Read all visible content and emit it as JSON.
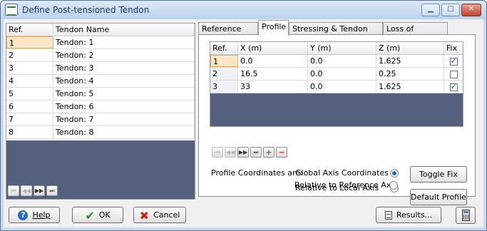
{
  "window": {
    "title": "Define Post-tensioned Tendon",
    "minimize_glyph": "▁",
    "maximize_glyph": "□",
    "close_glyph": "✕"
  },
  "tendon_list": {
    "headers": [
      "Ref.",
      "Tendon Name"
    ],
    "rows": [
      {
        "ref": "1",
        "name": "Tendon: 1"
      },
      {
        "ref": "2",
        "name": "Tendon: 2"
      },
      {
        "ref": "3",
        "name": "Tendon: 3"
      },
      {
        "ref": "4",
        "name": "Tendon: 4"
      },
      {
        "ref": "5",
        "name": "Tendon: 5"
      },
      {
        "ref": "6",
        "name": "Tendon: 6"
      },
      {
        "ref": "7",
        "name": "Tendon: 7"
      },
      {
        "ref": "8",
        "name": "Tendon: 8"
      }
    ],
    "selected_index": 0
  },
  "tabs": [
    {
      "label": "Reference Axis",
      "active": false
    },
    {
      "label": "Profile",
      "active": true
    },
    {
      "label": "Stressing & Tendon Data",
      "active": false
    },
    {
      "label": "Loss of Prestress",
      "active": false
    }
  ],
  "profile": {
    "headers": [
      "Ref.",
      "X (m)",
      "Y (m)",
      "Z (m)",
      "Fix"
    ],
    "rows": [
      {
        "ref": "1",
        "x": "0.0",
        "y": "0.0",
        "z": "1.625",
        "fix": true
      },
      {
        "ref": "2",
        "x": "16.5",
        "y": "0.0",
        "z": "0.25",
        "fix": false
      },
      {
        "ref": "3",
        "x": "33",
        "y": "0.0",
        "z": "1.625",
        "fix": true
      }
    ],
    "coordinates_label": "Profile Coordinates are:",
    "coordinate_options": [
      {
        "label": "Global Axis Coordinates",
        "selected": true
      },
      {
        "label": "Relative to Local Axis",
        "selected": false
      },
      {
        "label": "Relative to Reference Axis",
        "selected": false
      }
    ],
    "toggle_fix_label": "Toggle Fix",
    "default_profile_label": "Default Profile"
  },
  "nav_glyphs": {
    "first": "⏮",
    "prev": "◀◀",
    "next": "▶▶",
    "last": "⏭",
    "add": "+",
    "remove": "−"
  },
  "footer": {
    "help_label": "Help",
    "ok_label": "OK",
    "cancel_label": "Cancel",
    "results_label": "Results...",
    "help_glyph": "?",
    "ok_glyph": "✔",
    "cancel_glyph": "✖"
  }
}
